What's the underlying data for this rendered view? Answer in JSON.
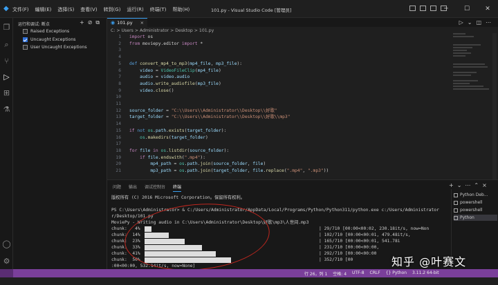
{
  "menu": [
    "文件(F)",
    "编辑(E)",
    "选择(S)",
    "查看(V)",
    "转到(G)",
    "运行(R)",
    "终端(T)",
    "帮助(H)"
  ],
  "window_title": "101.py - Visual Studio Code [管理员]",
  "sidebar": {
    "title": "运行和调试: 断点",
    "breakpoints": [
      {
        "label": "Raised Exceptions",
        "checked": false
      },
      {
        "label": "Uncaught Exceptions",
        "checked": true
      },
      {
        "label": "User Uncaught Exceptions",
        "checked": false
      }
    ]
  },
  "tab": {
    "label": "101.py"
  },
  "breadcrumb": "C: > Users > Administrator > Desktop > 101.py",
  "code": [
    {
      "n": "1",
      "html": "<span class='kw'>import</span> <span class='pl'>os</span>"
    },
    {
      "n": "2",
      "html": "<span class='kw'>from</span> <span class='pl'>moviepy.editor</span> <span class='kw'>import</span> <span class='pl'>*</span>"
    },
    {
      "n": "3",
      "html": ""
    },
    {
      "n": "4",
      "html": ""
    },
    {
      "n": "5",
      "html": "<span class='bl'>def</span> <span class='fn'>convert_mp4_to_mp3</span><span class='pl'>(</span><span class='vr'>mp4_file</span><span class='pl'>, </span><span class='vr'>mp3_file</span><span class='pl'>):</span>"
    },
    {
      "n": "6",
      "html": "    <span class='vr'>video</span> <span class='pl'>=</span> <span class='cl'>VideoFileClip</span><span class='pl'>(</span><span class='vr'>mp4_file</span><span class='pl'>)</span>"
    },
    {
      "n": "7",
      "html": "    <span class='vr'>audio</span> <span class='pl'>=</span> <span class='vr'>video</span><span class='pl'>.</span><span class='vr'>audio</span>"
    },
    {
      "n": "8",
      "html": "    <span class='vr'>audio</span><span class='pl'>.</span><span class='fn'>write_audiofile</span><span class='pl'>(</span><span class='vr'>mp3_file</span><span class='pl'>)</span>"
    },
    {
      "n": "9",
      "html": "    <span class='vr'>video</span><span class='pl'>.</span><span class='fn'>close</span><span class='pl'>()</span>"
    },
    {
      "n": "10",
      "html": ""
    },
    {
      "n": "11",
      "html": ""
    },
    {
      "n": "12",
      "html": "<span class='vr'>source_folder</span> <span class='pl'>=</span> <span class='st'>\"C:\\\\Users\\\\Administrator\\\\Desktop\\\\好歌\"</span>"
    },
    {
      "n": "13",
      "html": "<span class='vr'>target_folder</span> <span class='pl'>=</span> <span class='st'>\"C:\\\\Users\\\\Administrator\\\\Desktop\\\\好歌\\\\mp3\"</span>"
    },
    {
      "n": "14",
      "html": ""
    },
    {
      "n": "15",
      "html": "<span class='kw'>if</span> <span class='bl'>not</span> <span class='cl'>os</span><span class='pl'>.</span><span class='vr'>path</span><span class='pl'>.</span><span class='fn'>exists</span><span class='pl'>(</span><span class='vr'>target_folder</span><span class='pl'>):</span>"
    },
    {
      "n": "16",
      "html": "    <span class='cl'>os</span><span class='pl'>.</span><span class='fn'>makedirs</span><span class='pl'>(</span><span class='vr'>target_folder</span><span class='pl'>)</span>"
    },
    {
      "n": "17",
      "html": ""
    },
    {
      "n": "18",
      "html": "<span class='kw'>for</span> <span class='vr'>file</span> <span class='kw'>in</span> <span class='cl'>os</span><span class='pl'>.</span><span class='fn'>listdir</span><span class='pl'>(</span><span class='vr'>source_folder</span><span class='pl'>):</span>"
    },
    {
      "n": "19",
      "html": "    <span class='kw'>if</span> <span class='vr'>file</span><span class='pl'>.</span><span class='fn'>endswith</span><span class='pl'>(</span><span class='st'>\".mp4\"</span><span class='pl'>):</span>"
    },
    {
      "n": "20",
      "html": "        <span class='vr'>mp4_path</span> <span class='pl'>=</span> <span class='cl'>os</span><span class='pl'>.</span><span class='vr'>path</span><span class='pl'>.</span><span class='fn'>join</span><span class='pl'>(</span><span class='vr'>source_folder</span><span class='pl'>, </span><span class='vr'>file</span><span class='pl'>)</span>"
    },
    {
      "n": "21",
      "html": "        <span class='vr'>mp3_path</span> <span class='pl'>=</span> <span class='cl'>os</span><span class='pl'>.</span><span class='vr'>path</span><span class='pl'>.</span><span class='fn'>join</span><span class='pl'>(</span><span class='vr'>target_folder</span><span class='pl'>, </span><span class='vr'>file</span><span class='pl'>.</span><span class='fn'>replace</span><span class='pl'>(</span><span class='st'>\".mp4\"</span><span class='pl'>, </span><span class='st'>\".mp3\"</span><span class='pl'>))</span>"
    }
  ],
  "panel_tabs": [
    "问题",
    "输出",
    "调试控制台",
    "终端"
  ],
  "panel_active": 3,
  "terminal": {
    "lines": [
      "版权所有 (C) 2016 Microsoft Corporation。保留所有权利。",
      "",
      "PS C:\\Users\\Administrator> & C:/Users/Administrator/AppData/Local/Programs/Python/Python311/python.exe c:/Users/Administrator",
      "r/Desktop/101.py",
      "MoviePy - Writing audio in C:\\Users\\Administrator\\Desktop\\好歌\\mp3\\人世间.mp3"
    ],
    "progress": [
      {
        "label": "chunk:   4%",
        "fraction": 0.04,
        "stat": "| 29/710 [00:00<00:02, 230.18it/s, now=Non"
      },
      {
        "label": "chunk:  14%",
        "fraction": 0.14,
        "stat": "| 102/710 [00:00<00:01, 479.48it/s,"
      },
      {
        "label": "chunk:  23%",
        "fraction": 0.23,
        "stat": "| 165/710 [00:00<00:01, 541.78i"
      },
      {
        "label": "chunk:  33%",
        "fraction": 0.33,
        "stat": "| 231/710 [00:00<00:00,"
      },
      {
        "label": "chunk:  41%",
        "fraction": 0.41,
        "stat": "| 292/710 [00:00<00:00"
      },
      {
        "label": "chunk:  50%",
        "fraction": 0.5,
        "stat": "| 352/710 [00"
      }
    ],
    "last_line": ":00<00:00, 532.14it/s, now=None]"
  },
  "terminal_list": [
    "Python Deb...",
    "powershell",
    "powershell",
    "Python"
  ],
  "terminal_list_selected": 3,
  "status": [
    "行 26，列 1",
    "空格: 4",
    "UTF-8",
    "CRLF",
    "{} Python",
    "3.11.2 64-bit"
  ],
  "watermark": "知乎 @叶赛文"
}
